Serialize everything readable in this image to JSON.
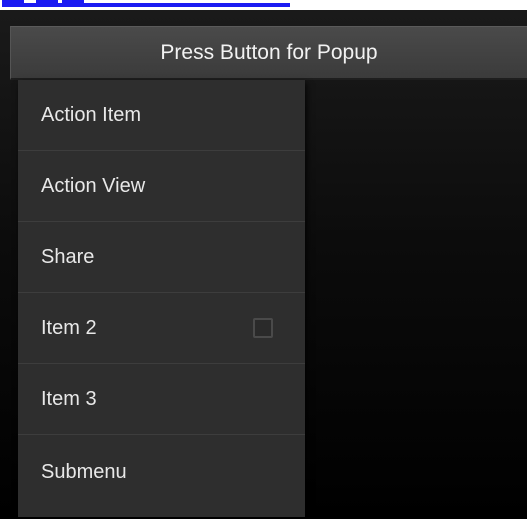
{
  "popup_button": {
    "label": "Press Button for Popup"
  },
  "menu": {
    "items": [
      {
        "label": "Action Item"
      },
      {
        "label": "Action View"
      },
      {
        "label": "Share"
      },
      {
        "label": "Item 2",
        "checkable": true,
        "checked": false
      },
      {
        "label": "Item 3"
      },
      {
        "label": "Submenu"
      }
    ]
  },
  "colors": {
    "link_blue": "#1a1af2",
    "menu_background": "#2e2e2e",
    "button_background": "#444444",
    "app_background": "#0c0c0c"
  }
}
